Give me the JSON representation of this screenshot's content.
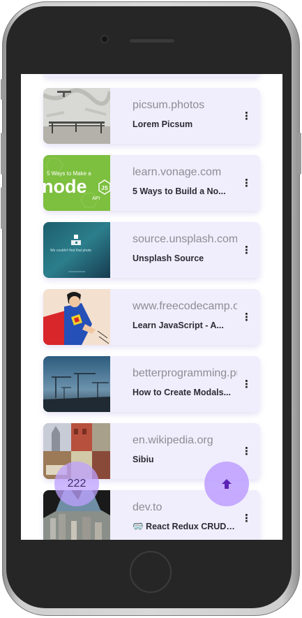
{
  "cards": [
    {
      "domain": "picsum.photos",
      "title": "Lorem Picsum",
      "image": "bench-wall-photo"
    },
    {
      "domain": "learn.vonage.com",
      "title": "5 Ways to Build a No...",
      "image": "node-logo-banner"
    },
    {
      "domain": "source.unsplash.com",
      "title": "Unsplash Source",
      "image": "unsplash-not-found"
    },
    {
      "domain": "www.freecodecamp.org",
      "title": "Learn JavaScript - A...",
      "image": "superman-comic"
    },
    {
      "domain": "betterprogramming.pu...",
      "title": "How to Create Modals...",
      "image": "cranes-skyline"
    },
    {
      "domain": "en.wikipedia.org",
      "title": "Sibiu",
      "image": "sibiu-collage"
    },
    {
      "domain": "dev.to",
      "title": "🥽 React Redux CRUD ...",
      "image": "city-aerial"
    }
  ],
  "thumb_texts": {
    "node_banner_top": "5 Ways to    Make a",
    "node_word": "node",
    "node_js": "JS",
    "node_api": "API",
    "unsplash_msg": "We couldn't find that photo"
  },
  "fab": {
    "count": "222",
    "scroll_top_icon": "arrow-up-icon"
  },
  "colors": {
    "card_bg": "#f0eefc",
    "fab": "#bea0ff",
    "accent": "#5b21b6"
  }
}
